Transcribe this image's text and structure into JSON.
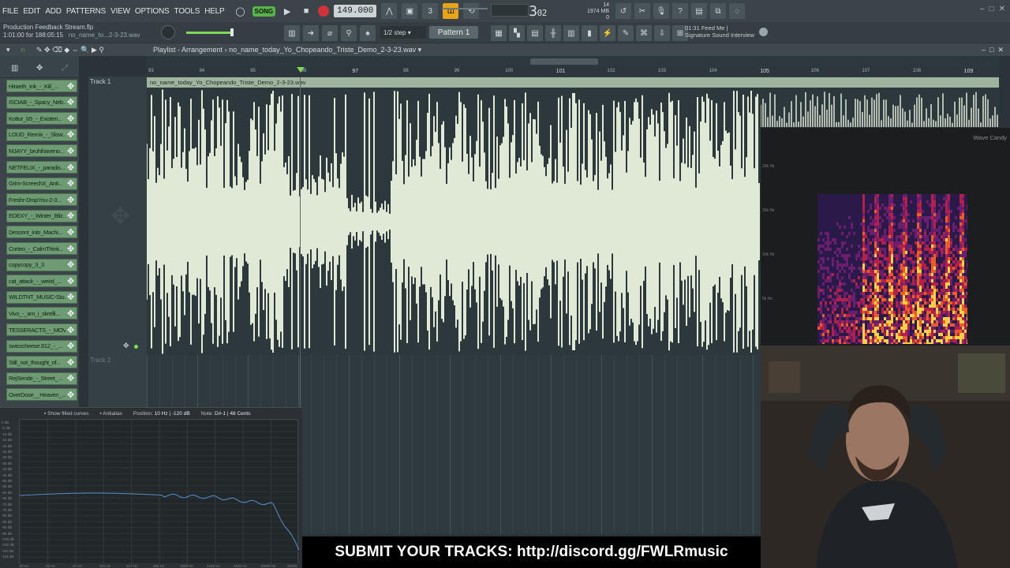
{
  "menu": [
    "FILE",
    "EDIT",
    "ADD",
    "PATTERNS",
    "VIEW",
    "OPTIONS",
    "TOOLS",
    "HELP"
  ],
  "transport": {
    "song_label": "SONG",
    "tempo": "149.000",
    "time_main": "2:33",
    "time_sub": "02",
    "time_unit": "M:S:CS"
  },
  "meters": {
    "cpu": "14",
    "mem": "1974 MB",
    "poly": "0"
  },
  "project": {
    "name": "Production Feedback Stream.flp",
    "time": "1:01:00 for 188:05:15",
    "sample": "no_name_to...2-3-23.wav"
  },
  "toolbar": {
    "step": "1/2 step",
    "pattern": "Pattern 1"
  },
  "hint": {
    "line1": "01:31  Feed Me |",
    "line2": "Signature Sound Interview"
  },
  "playlist": {
    "title": "Playlist - Arrangement",
    "separator": "›",
    "clip": "no_name_today_Yo_Chopeando_Triste_Demo_2-3-23.wav",
    "clip_label": "no_name_today_Yo_Chopeando_Triste_Demo_2-3-23.wav"
  },
  "tracks_header": {
    "track1": "Track 1",
    "track2": "Track 2"
  },
  "ruler": [
    "93",
    "94",
    "95",
    "96",
    "97",
    "98",
    "99",
    "100",
    "101",
    "102",
    "103",
    "104",
    "105",
    "106",
    "107",
    "108",
    "109"
  ],
  "browser_items": [
    "Hiraeth_Ink_-_Kill_...",
    "ISCIAB_-_Spacy_Neb...",
    "Kottur_b5_-_Existen...",
    "LOUD_Remix_-_Slow...",
    "MJAYY_bruhihaveno...",
    "NETFELIX_-_paradis...",
    "Grim-ScreechX_Anti...",
    "Freshr-DropYou-2-3...",
    "EDEXY_-_Winter_Bliz...",
    "Descent_into_Machi...",
    "Corteo_-_CalmThink...",
    "copycopy_3_3",
    "cat_attack_-_weird_...",
    "WILDTNT_MUSIC-Stu...",
    "Vivo_-_am_i_skrelli...",
    "TESSERACTS_-_MOVE...",
    "swisscheese.912_-_...",
    "Still_not_thought_of...",
    "RejSende_-_Street_...",
    "OverDose__Heaven_..."
  ],
  "wavecandy": {
    "title": "Wave Candy",
    "labels": [
      "20k Hz",
      "15k Hz",
      "10k Hz",
      "5k Hz"
    ]
  },
  "eq": {
    "show_filled": "Show filled curves",
    "antialias": "Antialias",
    "position_label": "Position:",
    "position_value": "10 Hz | -120 dB",
    "note_label": "Note:",
    "note_value": "D#-1 | 48 Cents",
    "y_labels": [
      "0 dB",
      "-5 dB",
      "-10 dB",
      "-15 dB",
      "-20 dB",
      "-25 dB",
      "-30 dB",
      "-35 dB",
      "-40 dB",
      "-45 dB",
      "-50 dB",
      "-55 dB",
      "-60 dB",
      "-65 dB",
      "-70 dB",
      "-75 dB",
      "-80 dB",
      "-85 dB",
      "-90 dB",
      "-95 dB",
      "-100 dB",
      "-105 dB",
      "-110 dB",
      "-115 dB"
    ],
    "x_labels": [
      "10 Hz",
      "22 Hz",
      "47 Hz",
      "101 Hz",
      "217 Hz",
      "465 Hz",
      "1000 Hz",
      "2150 Hz",
      "4620 Hz",
      "10000 Hz",
      "20000 Hz"
    ]
  },
  "banner": "SUBMIT YOUR TRACKS: http://discord.gg/FWLRmusic",
  "colors": {
    "accent": "#e8a317",
    "clip": "#9fb39f",
    "wave": "#dfe9d6",
    "record": "#d0343a",
    "song": "#58b34a"
  }
}
